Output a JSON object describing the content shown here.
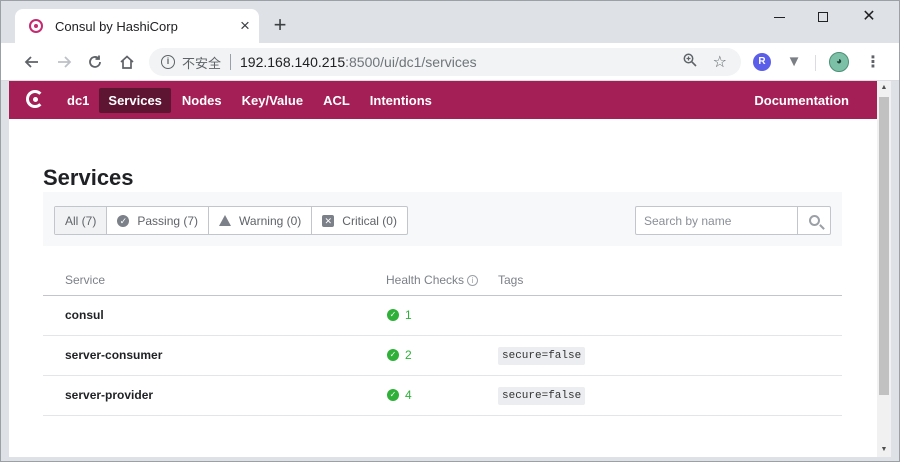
{
  "browser": {
    "tab_title": "Consul by HashiCorp",
    "tab_close": "×",
    "new_tab": "+",
    "window_close": "✕",
    "security_label": "不安全",
    "url_host": "192.168.140.215",
    "url_rest": ":8500/ui/dc1/services"
  },
  "nav": {
    "datacenter": "dc1",
    "items": [
      {
        "label": "Services",
        "active": true
      },
      {
        "label": "Nodes"
      },
      {
        "label": "Key/Value"
      },
      {
        "label": "ACL"
      },
      {
        "label": "Intentions"
      }
    ],
    "documentation": "Documentation"
  },
  "page": {
    "title": "Services",
    "filters": [
      {
        "label": "All (7)",
        "active": true
      },
      {
        "label": "Passing (7)",
        "icon": "check-circle-icon"
      },
      {
        "label": "Warning (0)",
        "icon": "warning-icon"
      },
      {
        "label": "Critical (0)",
        "icon": "critical-icon"
      }
    ],
    "search_placeholder": "Search by name"
  },
  "table": {
    "headers": {
      "service": "Service",
      "health": "Health Checks",
      "tags": "Tags"
    },
    "rows": [
      {
        "name": "consul",
        "checks": "1",
        "tag": ""
      },
      {
        "name": "server-consumer",
        "checks": "2",
        "tag": "secure=false"
      },
      {
        "name": "server-provider",
        "checks": "4",
        "tag": "secure=false"
      }
    ]
  },
  "colors": {
    "brand": "#a31f55",
    "passing": "#2eb039"
  }
}
